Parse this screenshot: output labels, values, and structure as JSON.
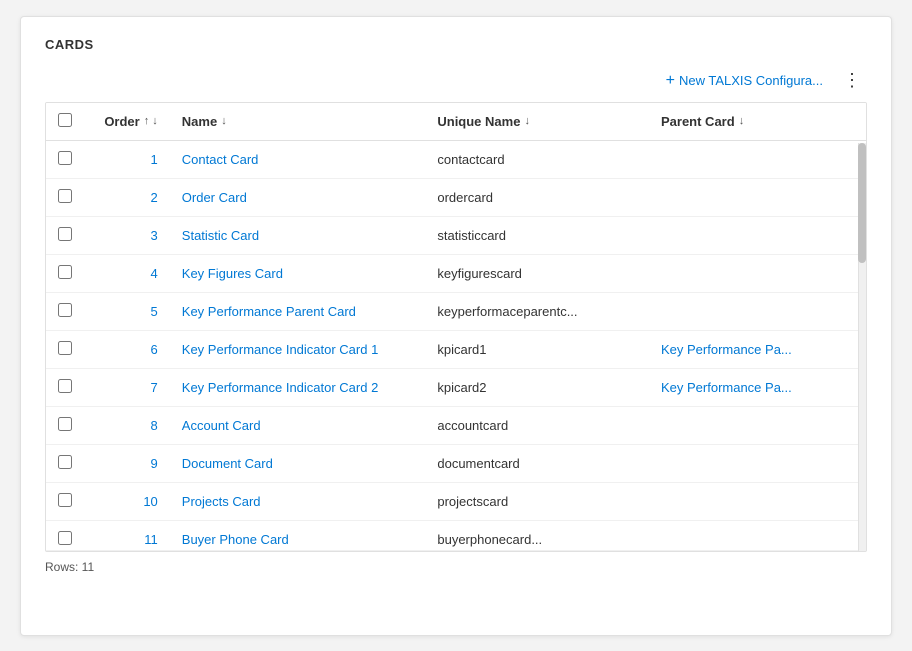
{
  "page": {
    "title": "CARDS",
    "rows_label": "Rows: 11"
  },
  "toolbar": {
    "new_button_label": "New TALXIS Configura...",
    "plus_icon": "+",
    "more_icon": "⋮"
  },
  "table": {
    "columns": [
      {
        "key": "checkbox",
        "label": ""
      },
      {
        "key": "order",
        "label": "Order",
        "sort": "↑ ↓"
      },
      {
        "key": "name",
        "label": "Name",
        "sort": "↓"
      },
      {
        "key": "unique_name",
        "label": "Unique Name",
        "sort": "↓"
      },
      {
        "key": "parent_card",
        "label": "Parent Card",
        "sort": "↓"
      }
    ],
    "rows": [
      {
        "order": "1",
        "name": "Contact Card",
        "unique_name": "contactcard",
        "parent_card": ""
      },
      {
        "order": "2",
        "name": "Order Card",
        "unique_name": "ordercard",
        "parent_card": ""
      },
      {
        "order": "3",
        "name": "Statistic Card",
        "unique_name": "statisticcard",
        "parent_card": ""
      },
      {
        "order": "4",
        "name": "Key Figures Card",
        "unique_name": "keyfigurescard",
        "parent_card": ""
      },
      {
        "order": "5",
        "name": "Key Performance Parent Card",
        "unique_name": "keyperformaceparentc...",
        "parent_card": ""
      },
      {
        "order": "6",
        "name": "Key Performance Indicator Card 1",
        "unique_name": "kpicard1",
        "parent_card": "Key Performance Pa..."
      },
      {
        "order": "7",
        "name": "Key Performance Indicator Card 2",
        "unique_name": "kpicard2",
        "parent_card": "Key Performance Pa..."
      },
      {
        "order": "8",
        "name": "Account Card",
        "unique_name": "accountcard",
        "parent_card": ""
      },
      {
        "order": "9",
        "name": "Document Card",
        "unique_name": "documentcard",
        "parent_card": ""
      },
      {
        "order": "10",
        "name": "Projects Card",
        "unique_name": "projectscard",
        "parent_card": ""
      }
    ],
    "partial_row": {
      "order": "11",
      "name": "Buyer Phone Card",
      "unique_name": "buyerphonecard..."
    }
  },
  "colors": {
    "link": "#0078d4",
    "text": "#333333",
    "border": "#e0e0e0",
    "header_bg": "#ffffff",
    "row_hover": "#f5f9ff"
  }
}
